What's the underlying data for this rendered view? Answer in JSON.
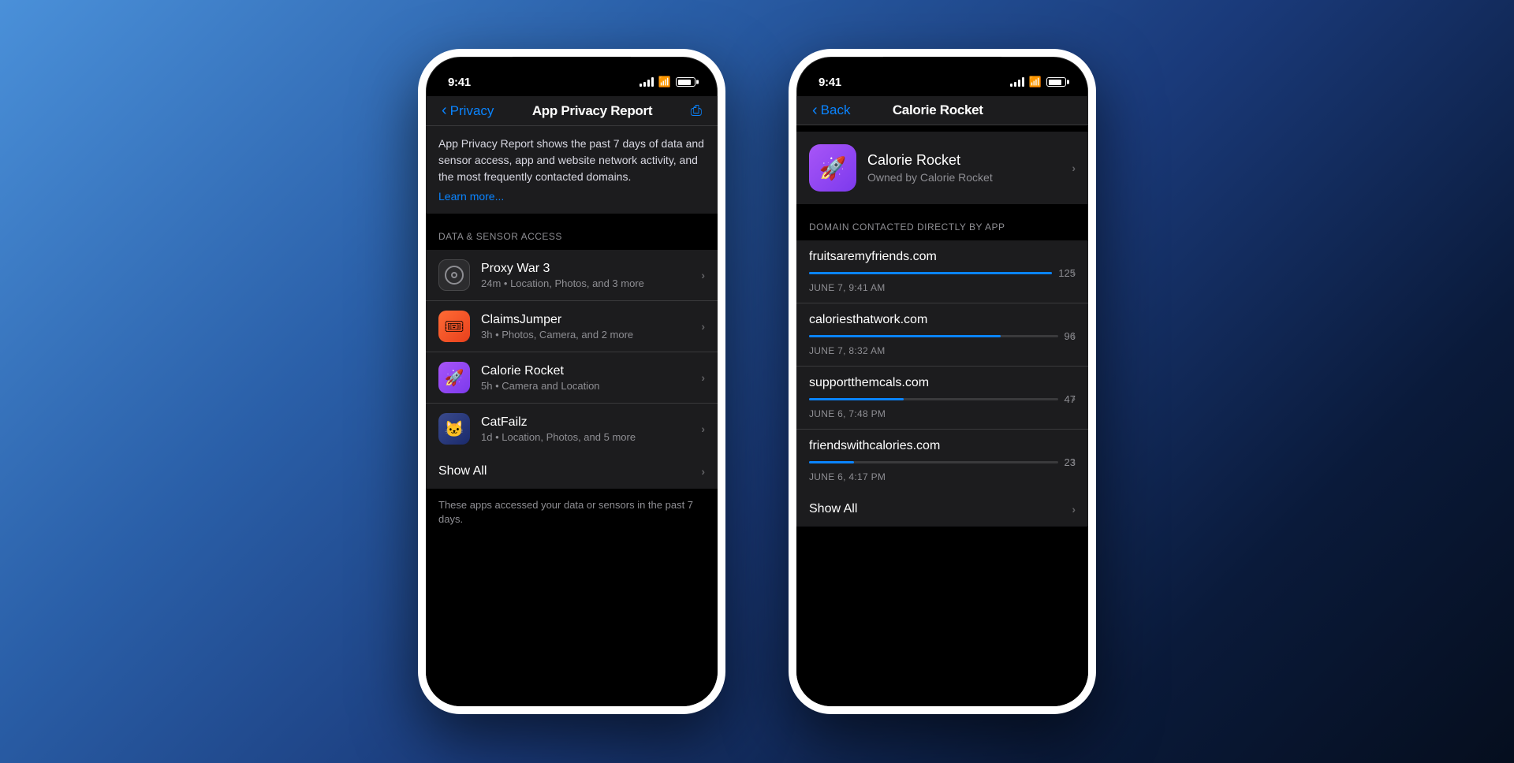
{
  "background": {
    "gradient": "linear-gradient(135deg, #4a90d9, #2a5fa8, #1a3a7a, #0a1a3a)"
  },
  "phone_left": {
    "status_bar": {
      "time": "9:41",
      "signal": "●●●●",
      "wifi": "wifi",
      "battery": "battery"
    },
    "nav": {
      "back_label": "Privacy",
      "title": "App Privacy Report",
      "action": "share"
    },
    "info_section": {
      "text": "App Privacy Report shows the past 7 days of data and sensor access, app and website network activity, and the most frequently contacted domains.",
      "link": "Learn more..."
    },
    "data_sensor_header": "DATA & SENSOR ACCESS",
    "apps": [
      {
        "name": "Proxy War 3",
        "subtitle": "24m • Location, Photos, and 3 more",
        "icon_type": "proxywar"
      },
      {
        "name": "ClaimsJumper",
        "subtitle": "3h • Photos, Camera, and 2 more",
        "icon_type": "claimsjumper"
      },
      {
        "name": "Calorie Rocket",
        "subtitle": "5h • Camera and Location",
        "icon_type": "calorierocket"
      },
      {
        "name": "CatFailz",
        "subtitle": "1d • Location, Photos, and 5 more",
        "icon_type": "catfailz"
      }
    ],
    "show_all": "Show All",
    "footer_note": "These apps accessed your data or sensors in the past 7 days."
  },
  "phone_right": {
    "status_bar": {
      "time": "9:41",
      "signal": "●●●●",
      "wifi": "wifi",
      "battery": "battery"
    },
    "nav": {
      "back_label": "Back",
      "title": "Calorie Rocket"
    },
    "app_info": {
      "name": "Calorie Rocket",
      "owner": "Owned by Calorie Rocket",
      "icon_type": "calorierocket"
    },
    "domain_header": "DOMAIN CONTACTED DIRECTLY BY APP",
    "domains": [
      {
        "name": "fruitsaremyfriends.com",
        "count": 125,
        "bar_pct": 100,
        "date": "June 7, 9:41 AM"
      },
      {
        "name": "caloriesthatwork.com",
        "count": 96,
        "bar_pct": 77,
        "date": "June 7, 8:32 AM"
      },
      {
        "name": "supportthemcals.com",
        "count": 47,
        "bar_pct": 38,
        "date": "June 6, 7:48 PM"
      },
      {
        "name": "friendswithcalories.com",
        "count": 23,
        "bar_pct": 18,
        "date": "June 6, 4:17 PM"
      }
    ],
    "show_all": "Show All"
  }
}
